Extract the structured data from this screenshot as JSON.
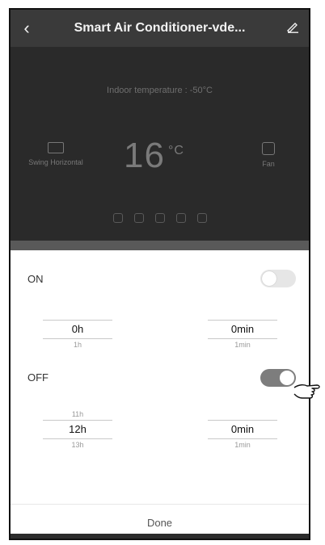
{
  "header": {
    "title": "Smart Air Conditioner-vde..."
  },
  "ac": {
    "indoor_temperature": "Indoor temperature : -50°C",
    "swing_label": "Swing Horizontal",
    "temperature": "16",
    "unit": "°C",
    "fan_label": "Fan"
  },
  "timer": {
    "on": {
      "label": "ON",
      "toggle_state": "off",
      "hours": {
        "selected": "0h",
        "next": "1h"
      },
      "minutes": {
        "selected": "0min",
        "next": "1min"
      }
    },
    "off": {
      "label": "OFF",
      "toggle_state": "on",
      "hours": {
        "previous": "11h",
        "selected": "12h",
        "next": "13h"
      },
      "minutes": {
        "selected": "0min",
        "next": "1min"
      }
    },
    "done_label": "Done"
  },
  "icons": [
    "back-icon",
    "edit-icon",
    "swing-icon",
    "fan-icon",
    "pointing-hand-icon"
  ]
}
